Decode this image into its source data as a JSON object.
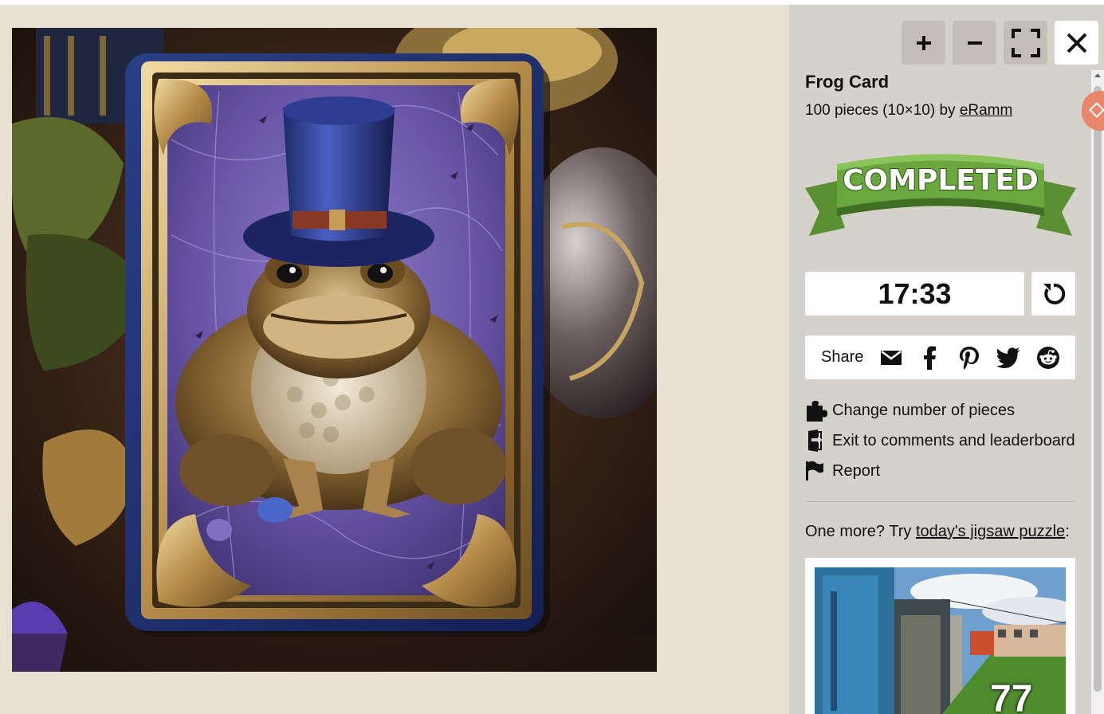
{
  "puzzle": {
    "title": "Frog Card",
    "pieces_text": "100 pieces (10×10) by ",
    "author": "eRamm"
  },
  "controls": {
    "zoom_in": "plus-icon",
    "zoom_out": "minus-icon",
    "fullscreen": "fullscreen-icon",
    "close": "close-icon"
  },
  "status": {
    "badge": "COMPLETED",
    "timer": "17:33"
  },
  "share": {
    "label": "Share",
    "icons": [
      "email-icon",
      "facebook-icon",
      "pinterest-icon",
      "twitter-icon",
      "reddit-icon"
    ]
  },
  "menu": [
    {
      "label": "Change number of pieces",
      "icon": "puzzle-piece-icon"
    },
    {
      "label": "Exit to comments and leaderboard",
      "icon": "exit-door-icon"
    },
    {
      "label": "Report",
      "icon": "flag-icon"
    }
  ],
  "promo": {
    "prefix": "One more? Try ",
    "link": "today's jigsaw puzzle",
    "suffix": ":",
    "thumbnail_number": "77"
  },
  "colors": {
    "page_bg": "#e8e1d3",
    "panel_bg": "#d5d2cb",
    "control_bg": "#c3bfb8",
    "banner_green": "#5e9b3a",
    "accent_orange": "#e9876b"
  }
}
